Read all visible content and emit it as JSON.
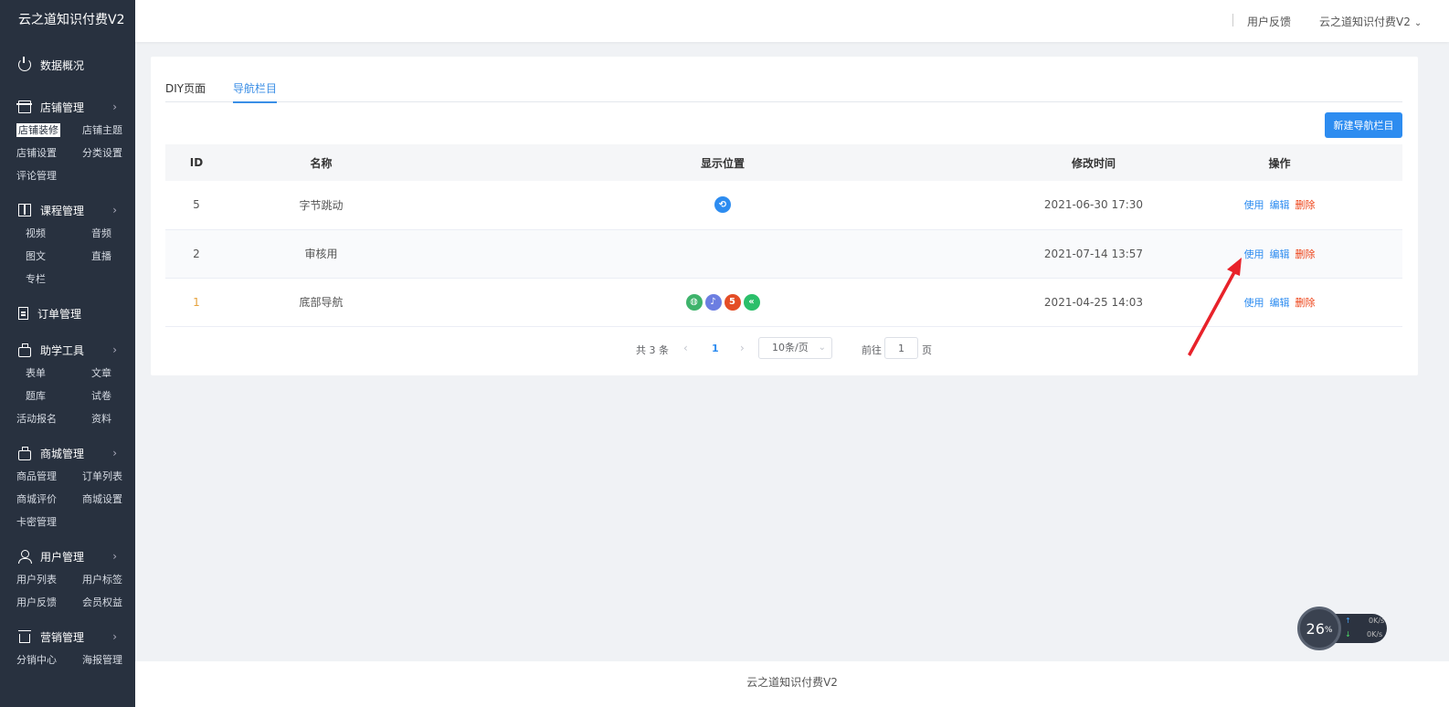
{
  "app": {
    "brand": "云之道知识付费V2"
  },
  "sidebar": {
    "top_item": {
      "label": "数据概况",
      "icon": "power-icon"
    },
    "groups": [
      {
        "label": "店铺管理",
        "icon": "store-icon",
        "items": [
          "店铺装修",
          "店铺主题",
          "店铺设置",
          "分类设置",
          "评论管理"
        ],
        "active": "店铺装修"
      },
      {
        "label": "课程管理",
        "icon": "book-icon",
        "items": [
          "视频",
          "音频",
          "图文",
          "直播",
          "专栏"
        ]
      },
      {
        "label": "订单管理",
        "icon": "doc-icon",
        "items": []
      },
      {
        "label": "助学工具",
        "icon": "bag-icon",
        "items": [
          "表单",
          "文章",
          "题库",
          "试卷",
          "活动报名",
          "资料"
        ]
      },
      {
        "label": "商城管理",
        "icon": "shop-icon",
        "items": [
          "商品管理",
          "订单列表",
          "商城评价",
          "商城设置",
          "卡密管理"
        ]
      },
      {
        "label": "用户管理",
        "icon": "user-icon",
        "items": [
          "用户列表",
          "用户标签",
          "用户反馈",
          "会员权益"
        ]
      },
      {
        "label": "营销管理",
        "icon": "shop-icon",
        "items": [
          "分销中心",
          "海报管理"
        ]
      }
    ]
  },
  "header": {
    "feedback": "用户反馈",
    "account": "云之道知识付费V2"
  },
  "tabs": [
    "DIY页面",
    "导航栏目"
  ],
  "active_tab": "导航栏目",
  "toolbar": {
    "new_label": "新建导航栏目"
  },
  "table": {
    "headers": [
      "ID",
      "名称",
      "显示位置",
      "修改时间",
      "操作"
    ],
    "rows": [
      {
        "id": "5",
        "name": "字节跳动",
        "positions": [
          "bytedance"
        ],
        "time": "2021-06-30 17:30",
        "ops": [
          "使用",
          "编辑",
          "删除"
        ]
      },
      {
        "id": "2",
        "name": "审核用",
        "positions": [],
        "time": "2021-07-14 13:57",
        "ops": [
          "使用",
          "编辑",
          "删除"
        ]
      },
      {
        "id": "1",
        "name": "底部导航",
        "positions": [
          "wechat",
          "douyin",
          "h5",
          "miniapp"
        ],
        "time": "2021-04-25 14:03",
        "ops": [
          "使用",
          "编辑",
          "删除"
        ]
      }
    ]
  },
  "position_icons": {
    "bytedance": {
      "color": "#2d8cf0",
      "glyph": "⟲"
    },
    "wechat": {
      "color": "#3eb36b",
      "glyph": "◍"
    },
    "douyin": {
      "color": "#6c7ee1",
      "glyph": "♪"
    },
    "h5": {
      "color": "#e44d26",
      "glyph": "5"
    },
    "miniapp": {
      "color": "#2bbf6a",
      "glyph": "«"
    }
  },
  "pagination": {
    "total": "共 3 条",
    "current": "1",
    "page_size": "10条/页",
    "goto": "前往",
    "jump_value": "1",
    "page_unit": "页"
  },
  "footer": {
    "text": "云之道知识付费V2"
  },
  "net_widget": {
    "percent": "26",
    "unit": "%",
    "up": "0K/s",
    "down": "0K/s"
  },
  "colors": {
    "sidebar": "#28313f",
    "accent": "#2d8cf0",
    "danger": "#ed4014"
  }
}
